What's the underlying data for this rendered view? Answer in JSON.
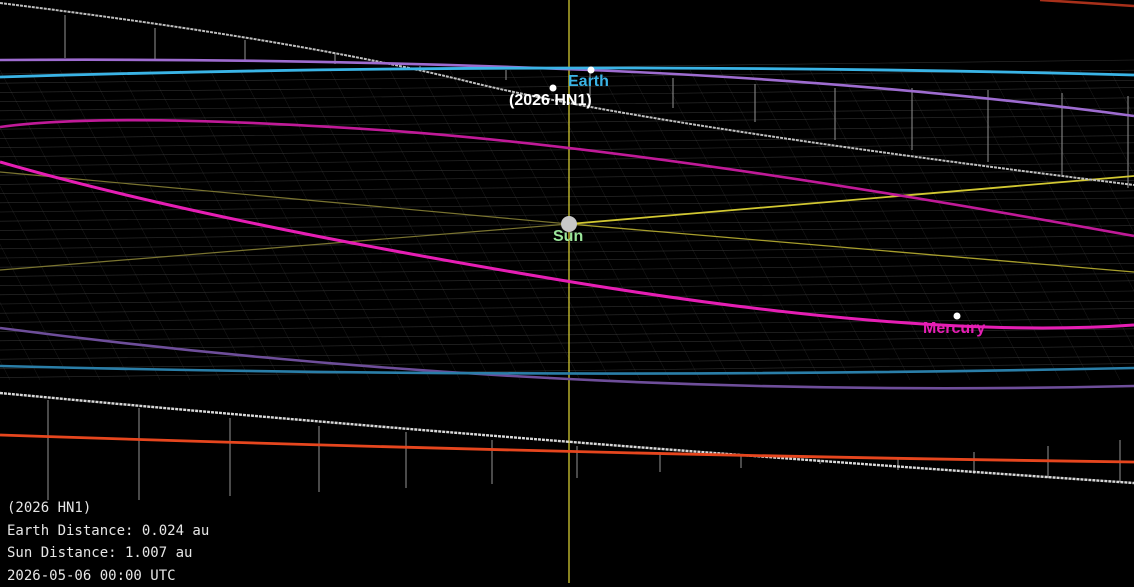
{
  "colors": {
    "background": "#000000",
    "earth": "#3ab4e6",
    "object": "#ffffff",
    "sun_label": "#9be69b",
    "sun_disc": "#c8c8c8",
    "mercury": "#e61eb4",
    "venus": "#9664c8",
    "mars": "#e6461e",
    "sun_axis": "#d2c832",
    "object_orbit": "#c8c8c8",
    "grid": "#555555"
  },
  "labels": {
    "earth": "Earth",
    "object": "(2026 HN1)",
    "sun": "Sun",
    "mercury": "Mercury"
  },
  "info": {
    "object_name": "(2026 HN1)",
    "earth_distance": "Earth Distance: 0.024 au",
    "sun_distance": "Sun Distance: 1.007 au",
    "datetime": "2026-05-06 00:00 UTC"
  },
  "scene_elements": {
    "orbits": [
      "object-orbit",
      "earth-orbit",
      "venus-orbit",
      "mercury-orbit",
      "mars-orbit"
    ],
    "bodies": [
      "sun",
      "earth",
      "object",
      "mercury"
    ],
    "icons": [
      "sun-icon",
      "earth-dot-icon",
      "object-dot-icon",
      "mercury-dot-icon"
    ]
  }
}
